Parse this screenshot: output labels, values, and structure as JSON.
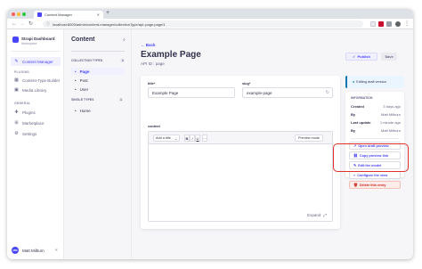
{
  "colors": {
    "accent": "#4945ff",
    "highlight": "#e0322d",
    "danger": "#d02b20",
    "info": "#0c75af"
  },
  "browser": {
    "tab_title": "Content Manager",
    "tab_close_icon": "close-icon",
    "new_tab": "+",
    "url": "localhost:8000/admin/content-manager/collectionType/api::page.page/1"
  },
  "brand": {
    "title": "Strapi Dashboard",
    "subtitle": "Workspace"
  },
  "mainnav": {
    "items": [
      {
        "label": "Content Manager",
        "icon": "feather-icon",
        "active": true
      },
      {
        "label": "Content-Type Builder",
        "icon": "layout-icon"
      },
      {
        "label": "Media Library",
        "icon": "image-icon"
      },
      {
        "label": "Plugins",
        "icon": "puzzle-icon"
      },
      {
        "label": "Marketplace",
        "icon": "cart-icon"
      },
      {
        "label": "Settings",
        "icon": "gear-icon"
      }
    ],
    "section_plugins": "PLUGINS",
    "section_general": "GENERAL",
    "user_initials": "MM",
    "user_name": "Matt Milburn"
  },
  "subnav": {
    "title": "Content",
    "collection_types": "COLLECTION TYPES",
    "collection_count": "3",
    "collection_items": [
      "Page",
      "Post",
      "User"
    ],
    "single_types": "SINGLE TYPES",
    "single_count": "1",
    "single_items": [
      "Home"
    ]
  },
  "header": {
    "back": "Back",
    "title": "Example Page",
    "api_id": "API ID : page",
    "publish": "Publish",
    "save": "Save"
  },
  "form": {
    "title_label": "title*",
    "title_value": "Example Page",
    "slug_label": "slug*",
    "slug_value": "example-page",
    "content_label": "content",
    "add_title": "Add a title",
    "preview_mode": "Preview mode",
    "expand": "Expand"
  },
  "sidebar": {
    "draft_notice": "Editing draft version",
    "info_head": "INFORMATION",
    "rows": [
      {
        "k": "Created",
        "v": "3 days ago"
      },
      {
        "k": "By",
        "v": "Matt Milburn"
      },
      {
        "k": "Last update",
        "v": "1 minute ago"
      },
      {
        "k": "By",
        "v": "Matt Milburn"
      }
    ],
    "actions": [
      {
        "label": "Open draft preview",
        "icon": "external-link-icon"
      },
      {
        "label": "Copy preview link",
        "icon": "link-icon"
      },
      {
        "label": "Edit the model",
        "icon": "pencil-icon"
      },
      {
        "label": "Configure the view",
        "icon": "layers-icon"
      },
      {
        "label": "Delete this entry",
        "icon": "trash-icon",
        "danger": true
      }
    ]
  }
}
